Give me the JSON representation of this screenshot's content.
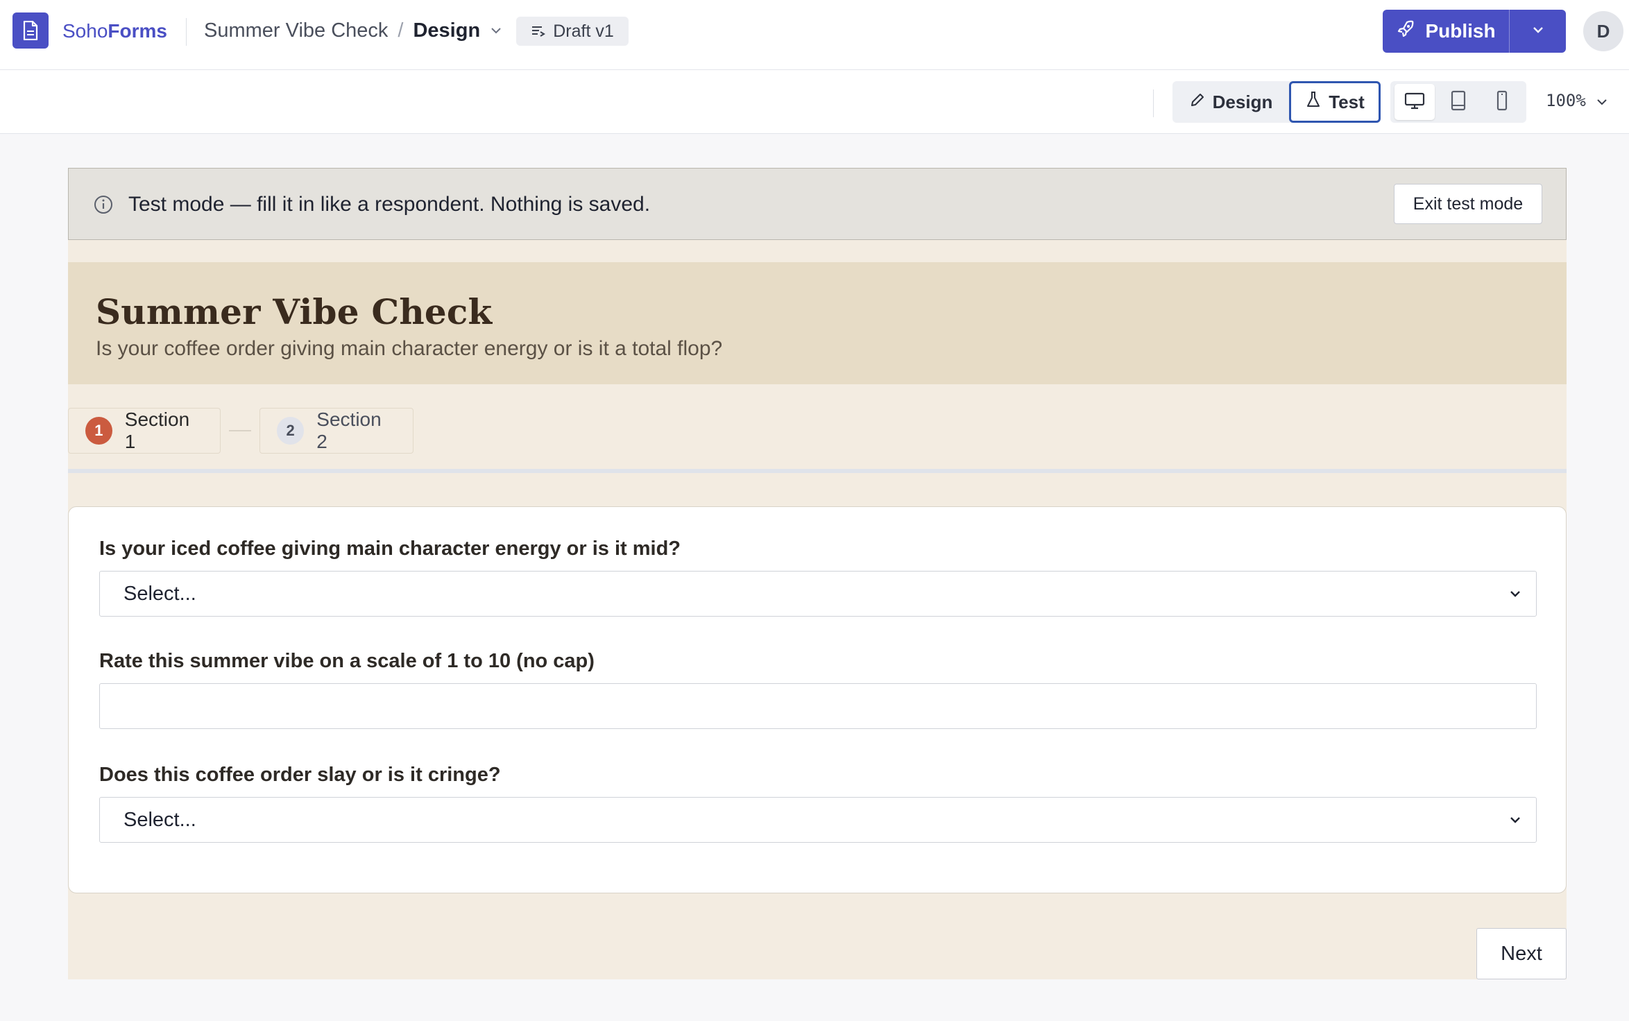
{
  "header": {
    "brand_light": "Soho",
    "brand_bold": "Forms",
    "form_name": "Summer Vibe Check",
    "separator": "/",
    "current_view": "Design",
    "draft_label": "Draft v1",
    "publish_label": "Publish",
    "avatar_initial": "D"
  },
  "toolbar": {
    "design_label": "Design",
    "test_label": "Test",
    "active_mode": "Test",
    "devices": [
      "desktop-icon",
      "tablet-icon",
      "mobile-icon"
    ],
    "active_device": "desktop",
    "zoom": "100%"
  },
  "banner": {
    "message": "Test mode — fill it in like a respondent. Nothing is saved.",
    "exit_label": "Exit test mode"
  },
  "form": {
    "title": "Summer Vibe Check",
    "subtitle": "Is your coffee order giving main character energy or is it a total flop?",
    "steps": [
      {
        "number": "1",
        "label": "Section 1",
        "active": true
      },
      {
        "number": "2",
        "label": "Section 2",
        "active": false
      }
    ],
    "questions": [
      {
        "label": "Is your iced coffee giving main character energy or is it mid?",
        "type": "select",
        "value": "Select..."
      },
      {
        "label": "Rate this summer vibe on a scale of 1 to 10 (no cap)",
        "type": "text",
        "value": ""
      },
      {
        "label": "Does this coffee order slay or is it cringe?",
        "type": "select",
        "value": "Select..."
      }
    ],
    "next_label": "Next"
  },
  "colors": {
    "brand": "#4a4fc4",
    "form_background": "#f3ece1",
    "header_band": "#e7dcc6",
    "active_step": "#cb5b3f",
    "test_outline": "#2f56b0"
  }
}
